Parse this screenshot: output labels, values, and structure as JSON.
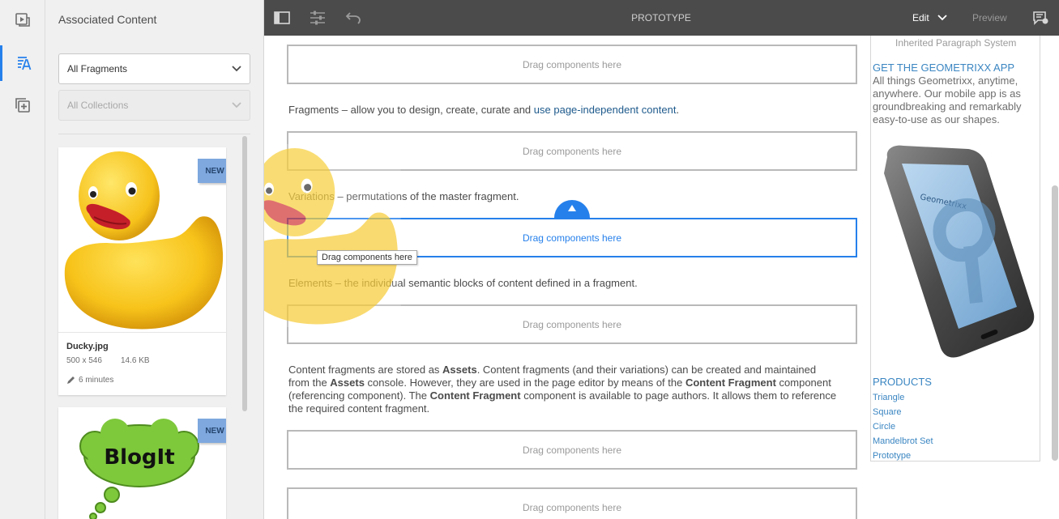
{
  "panel": {
    "title": "Associated Content",
    "filter_select": "All Fragments",
    "collection_select": "All Collections"
  },
  "cards": [
    {
      "name": "Ducky.jpg",
      "dimensions": "500 x 546",
      "size": "14.6 KB",
      "time": "6 minutes",
      "badge": "NEW"
    },
    {
      "badge": "NEW",
      "thumb_text": "BlogIt"
    }
  ],
  "toolbar": {
    "title": "PROTOTYPE",
    "mode": "Edit",
    "preview": "Preview"
  },
  "main": {
    "drop_label": "Drag components here",
    "tooltip": "Drag components here",
    "para_fragments_prefix": "Fragments – allow you to design, create, curate and ",
    "para_fragments_link": "use page-independent content",
    "para_fragments_suffix": ".",
    "para_variations": "Variations – permutations of the master fragment.",
    "para_elements": "Elements – the individual semantic blocks of content defined in a fragment.",
    "para_assets": {
      "t1": "Content fragments are stored as ",
      "b1": "Assets",
      "t2": ". Content fragments (and their variations) can be created and maintained from the ",
      "b2": "Assets",
      "t3": " console. However, they are used in the page editor by means of the ",
      "b3": "Content Fragment",
      "t4": " component (referencing component). The ",
      "b4": "Content Fragment",
      "t5": " component is available to page authors. It allows them to reference the required content fragment."
    }
  },
  "aside": {
    "top_text": "Inherited Paragraph System",
    "app_title": "GET THE GEOMETRIXX APP",
    "app_text": "All things Geometrixx, anytime, anywhere. Our mobile app is as groundbreaking and remarkably easy-to-use as our shapes.",
    "phone_label": "Geometrixx",
    "products_title": "PRODUCTS",
    "products": [
      "Triangle",
      "Square",
      "Circle",
      "Mandelbrot Set",
      "Prototype"
    ]
  },
  "colors": {
    "accent": "#2680eb",
    "toolbar": "#4b4b4b",
    "badge": "#7ea8de",
    "link": "#3b86c2"
  }
}
